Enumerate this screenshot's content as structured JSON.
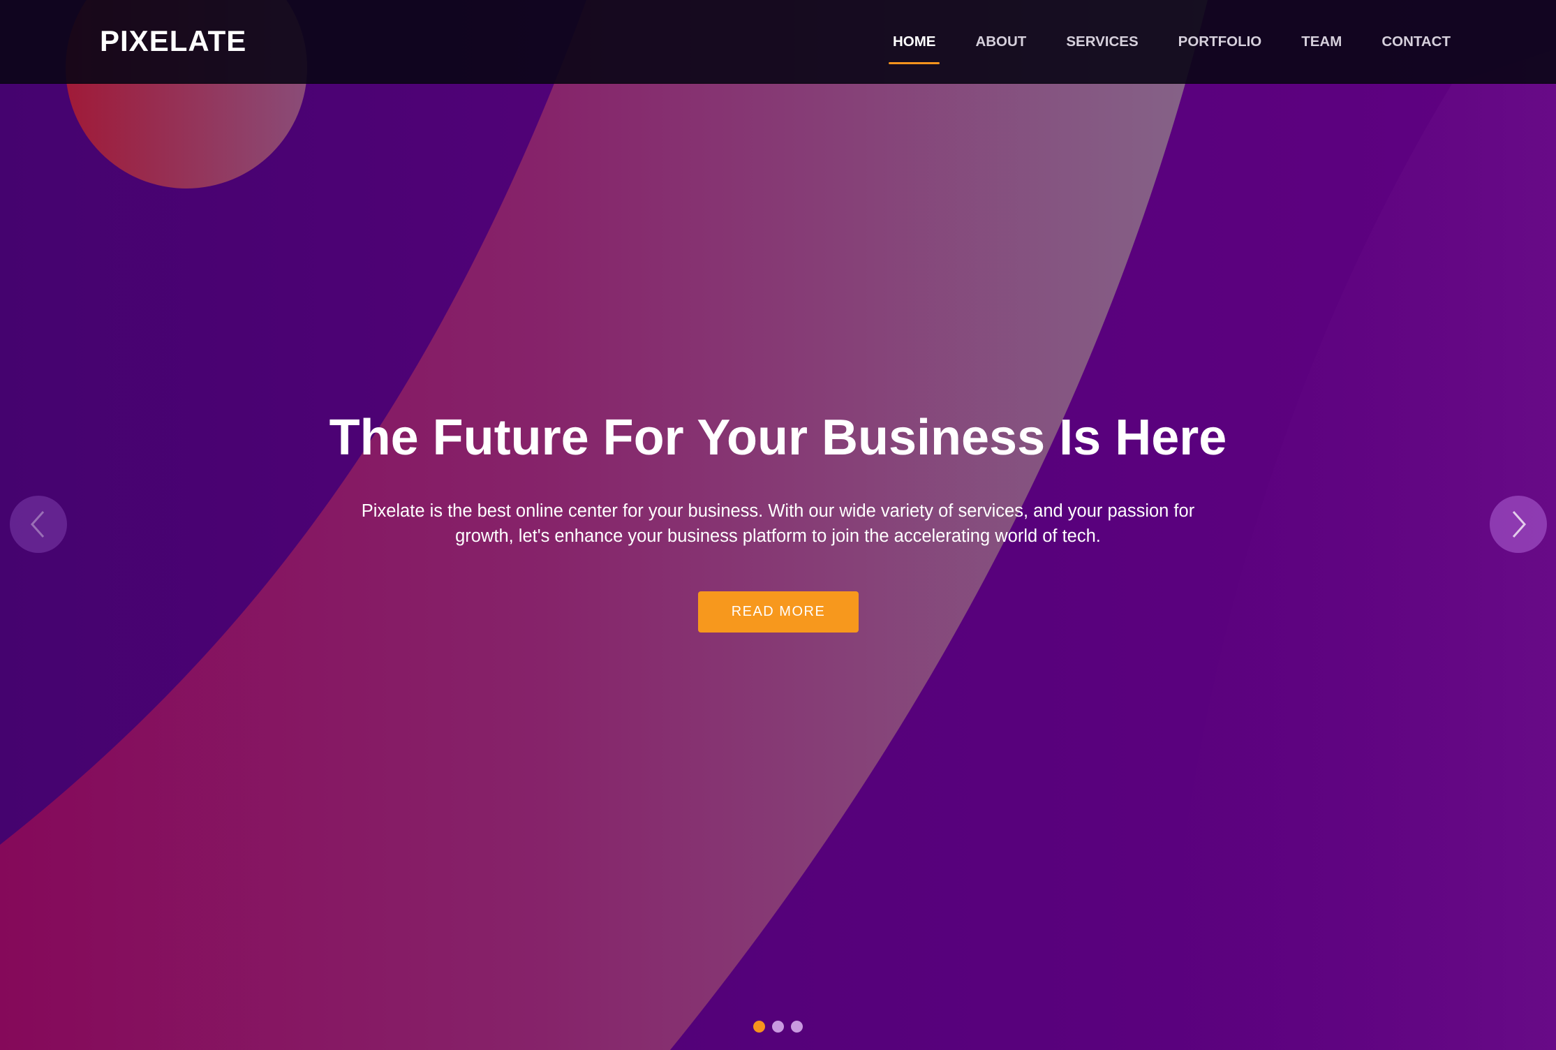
{
  "brand": {
    "name": "PIXELATE"
  },
  "nav": {
    "items": [
      {
        "label": "HOME",
        "active": true
      },
      {
        "label": "ABOUT",
        "active": false
      },
      {
        "label": "SERVICES",
        "active": false
      },
      {
        "label": "PORTFOLIO",
        "active": false
      },
      {
        "label": "TEAM",
        "active": false
      },
      {
        "label": "CONTACT",
        "active": false
      }
    ]
  },
  "hero": {
    "headline": "The Future For Your Business Is Here",
    "subtext": "Pixelate is the best online center for your business. With our wide variety of services, and your passion for growth, let's enhance your business platform to join the accelerating world of tech.",
    "cta_label": "READ MORE"
  },
  "carousel": {
    "prev_icon": "chevron-left-icon",
    "next_icon": "chevron-right-icon",
    "slide_count": 3,
    "active_slide": 1
  },
  "colors": {
    "accent": "#f7941d",
    "navbar_bg": "#0a0616",
    "hero_purple": "#5e0080",
    "hero_magenta": "#8a0a5a"
  }
}
